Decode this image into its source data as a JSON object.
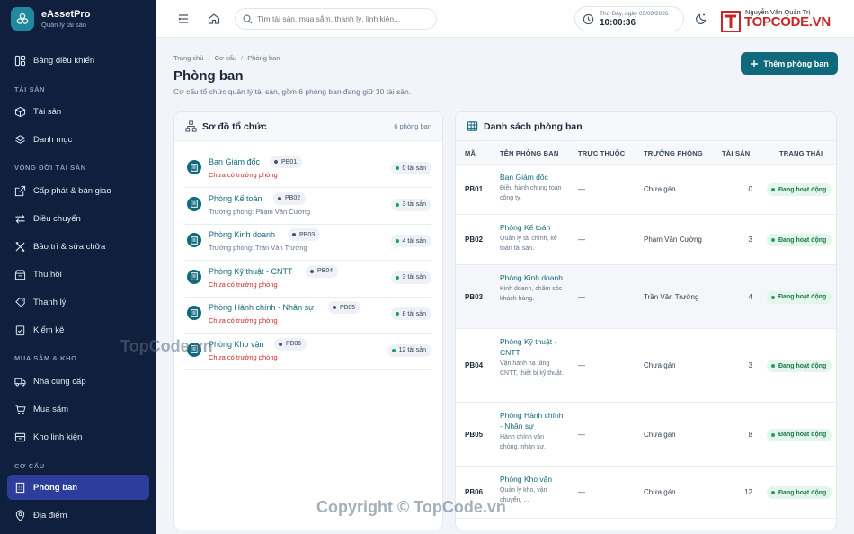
{
  "brand": {
    "name": "eAssetPro",
    "subtitle": "Quản lý tài sản"
  },
  "sidebar": {
    "dashboard": "Bảng điều khiển",
    "sections": [
      "TÀI SẢN",
      "VÒNG ĐỜI TÀI SẢN",
      "MUA SẮM & KHO",
      "CƠ CẤU"
    ],
    "items": [
      {
        "label": "Tài sản",
        "icon": "cube-icon"
      },
      {
        "label": "Danh mục",
        "icon": "tags-icon"
      },
      {
        "label": "Cấp phát & bàn giao",
        "icon": "handover-icon"
      },
      {
        "label": "Điều chuyển",
        "icon": "transfer-icon"
      },
      {
        "label": "Bảo trì & sửa chữa",
        "icon": "wrench-icon"
      },
      {
        "label": "Thu hồi",
        "icon": "return-icon"
      },
      {
        "label": "Thanh lý",
        "icon": "liquidate-icon"
      },
      {
        "label": "Kiểm kê",
        "icon": "inventory-icon"
      },
      {
        "label": "Nhà cung cấp",
        "icon": "truck-icon"
      },
      {
        "label": "Mua sắm",
        "icon": "cart-icon"
      },
      {
        "label": "Kho linh kiện",
        "icon": "box-icon"
      },
      {
        "label": "Phòng ban",
        "icon": "building-icon",
        "active": true
      },
      {
        "label": "Địa điểm",
        "icon": "map-pin-icon"
      }
    ]
  },
  "topbar": {
    "search_placeholder": "Tìm tài sản, mua sắm, thanh lý, linh kiện...",
    "date": "Thứ Bảy, ngày 05/09/2026",
    "time": "10:00:36",
    "user": "Nguyễn Văn Quản Trị",
    "logo_text": "TOPCODE.VN"
  },
  "page": {
    "breadcrumb": [
      "Trang chủ",
      "Cơ cấu",
      "Phòng ban"
    ],
    "title": "Phòng ban",
    "description": "Cơ cấu tổ chức quản lý tài sản, gồm 6 phòng ban đang giữ 30 tài sản.",
    "add_button": "Thêm phòng ban"
  },
  "org_chart": {
    "title": "Sơ đồ tổ chức",
    "count": "6 phòng ban",
    "items": [
      {
        "name": "Ban Giám đốc",
        "code": "PB01",
        "head": "Chưa có trưởng phòng",
        "assigned": false,
        "assets": "0 tài sản"
      },
      {
        "name": "Phòng Kế toán",
        "code": "PB02",
        "head": "Trưởng phòng: Phạm Văn Cường",
        "assigned": true,
        "assets": "3 tài sản"
      },
      {
        "name": "Phòng Kinh doanh",
        "code": "PB03",
        "head": "Trưởng phòng: Trần Văn Trường",
        "assigned": true,
        "assets": "4 tài sản"
      },
      {
        "name": "Phòng Kỹ thuật - CNTT",
        "code": "PB04",
        "head": "Chưa có trưởng phòng",
        "assigned": false,
        "assets": "3 tài sản"
      },
      {
        "name": "Phòng Hành chính - Nhân sự",
        "code": "PB05",
        "head": "Chưa có trưởng phòng",
        "assigned": false,
        "assets": "8 tài sản"
      },
      {
        "name": "Phòng Kho vận",
        "code": "PB06",
        "head": "Chưa có trưởng phòng",
        "assigned": false,
        "assets": "12 tài sản"
      }
    ]
  },
  "dept_table": {
    "title": "Danh sách phòng ban",
    "columns": [
      "MÃ",
      "TÊN PHÒNG BAN",
      "TRỰC THUỘC",
      "TRƯỞNG PHÒNG",
      "TÀI SẢN",
      "TRẠNG THÁI"
    ],
    "rows": [
      {
        "code": "PB01",
        "name": "Ban Giám đốc",
        "desc": "Điều hành chung toàn công ty.",
        "parent": "—",
        "head": "Chưa gán",
        "assets": "0",
        "status": "Đang hoạt động"
      },
      {
        "code": "PB02",
        "name": "Phòng Kế toán",
        "desc": "Quản lý tài chính, kế toán tài sản.",
        "parent": "—",
        "head": "Phạm Văn Cường",
        "assets": "3",
        "status": "Đang hoạt động"
      },
      {
        "code": "PB03",
        "name": "Phòng Kinh doanh",
        "desc": "Kinh doanh, chăm sóc khách hàng.",
        "parent": "—",
        "head": "Trần Văn Trường",
        "assets": "4",
        "status": "Đang hoạt động"
      },
      {
        "code": "PB04",
        "name": "Phòng Kỹ thuật - CNTT",
        "desc": "Vận hành hạ tầng CNTT, thiết bị kỹ thuật.",
        "parent": "—",
        "head": "Chưa gán",
        "assets": "3",
        "status": "Đang hoạt động"
      },
      {
        "code": "PB05",
        "name": "Phòng Hành chính - Nhân sự",
        "desc": "Hành chính văn phòng, nhân sự.",
        "parent": "—",
        "head": "Chưa gán",
        "assets": "8",
        "status": "Đang hoạt động"
      },
      {
        "code": "PB06",
        "name": "Phòng Kho vận",
        "desc": "Quản lý kho, vận chuyển, ...",
        "parent": "—",
        "head": "Chưa gán",
        "assets": "12",
        "status": "Đang hoạt động"
      }
    ]
  },
  "watermarks": [
    "TopCode.vn",
    "Copyright © TopCode.vn"
  ],
  "colors": {
    "accent": "#116a7b",
    "sidebar": "#0f1f3d",
    "active": "#2d3d9b",
    "danger": "#c62828",
    "success": "#18794e"
  }
}
